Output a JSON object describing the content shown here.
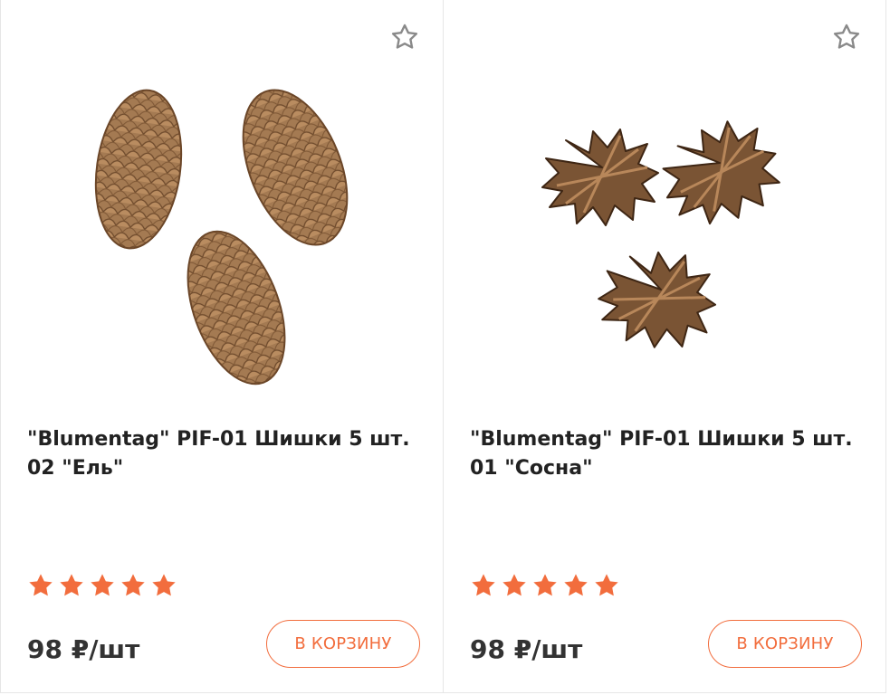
{
  "colors": {
    "accent": "#f26d3d",
    "star": "#f26d3d",
    "text": "#222222",
    "border": "#e6e6e6"
  },
  "products": [
    {
      "title_line1": "\"Blumentag\" PIF-01 Шишки 5 шт.",
      "title_line2": "02 \"Ель\"",
      "price": "98 ₽/шт",
      "rating": 5,
      "cart_label": "В КОРЗИНУ",
      "favorite_icon": "star-outline-icon",
      "image": "spruce-cones-photo"
    },
    {
      "title_line1": "\"Blumentag\" PIF-01 Шишки 5 шт.",
      "title_line2": "01 \"Сосна\"",
      "price": "98 ₽/шт",
      "rating": 5,
      "cart_label": "В КОРЗИНУ",
      "favorite_icon": "star-outline-icon",
      "image": "pine-cones-photo"
    }
  ]
}
